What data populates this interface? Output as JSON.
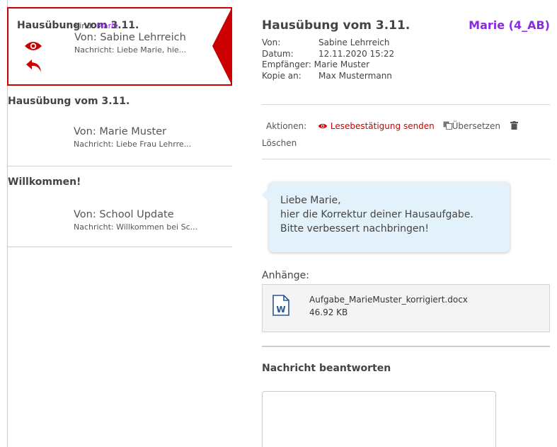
{
  "list": {
    "items": [
      {
        "title": "Hausübung vom 3.11.",
        "kid_label": "Kind:",
        "kid_name": "Marie",
        "from": "Von: Sabine Lehrreich",
        "preview": "Nachricht: Liebe Marie, hie..."
      },
      {
        "title": "Hausübung vom 3.11.",
        "from": "Von: Marie Muster",
        "preview": "Nachricht: Liebe Frau Lehrre..."
      },
      {
        "title": "Willkommen!",
        "from": "Von: School Update",
        "preview": "Nachricht: Willkommen bei Sc..."
      }
    ]
  },
  "detail": {
    "title": "Hausübung vom 3.11.",
    "student": "Marie (4_AB)",
    "headers": [
      {
        "label": "Von:",
        "value": "Sabine Lehrreich"
      },
      {
        "label": "Datum:",
        "value": "12.11.2020 15:22"
      },
      {
        "label": "Empfänger:",
        "value": "Marie Muster"
      },
      {
        "label": "Kopie an:",
        "value": "Max Mustermann"
      }
    ],
    "actions": {
      "label": "Aktionen:",
      "read_receipt": "Lesebestätigung senden",
      "translate": "Übersetzen",
      "delete": "Löschen"
    },
    "message_lines": [
      "Liebe Marie,",
      "hier die Korrektur deiner Hausaufgabe.",
      "Bitte verbessert nachbringen!"
    ],
    "attachments_label": "Anhänge:",
    "attachment": {
      "name": "Aufgabe_MarieMuster_korrigiert.docx",
      "size": "46.92 KB"
    },
    "reply_title": "Nachricht beantworten"
  },
  "colors": {
    "accent_red": "#cc0000",
    "student_purple": "#8a2be2",
    "bubble_bg": "#e3f2fa",
    "word_blue": "#2b5797"
  }
}
